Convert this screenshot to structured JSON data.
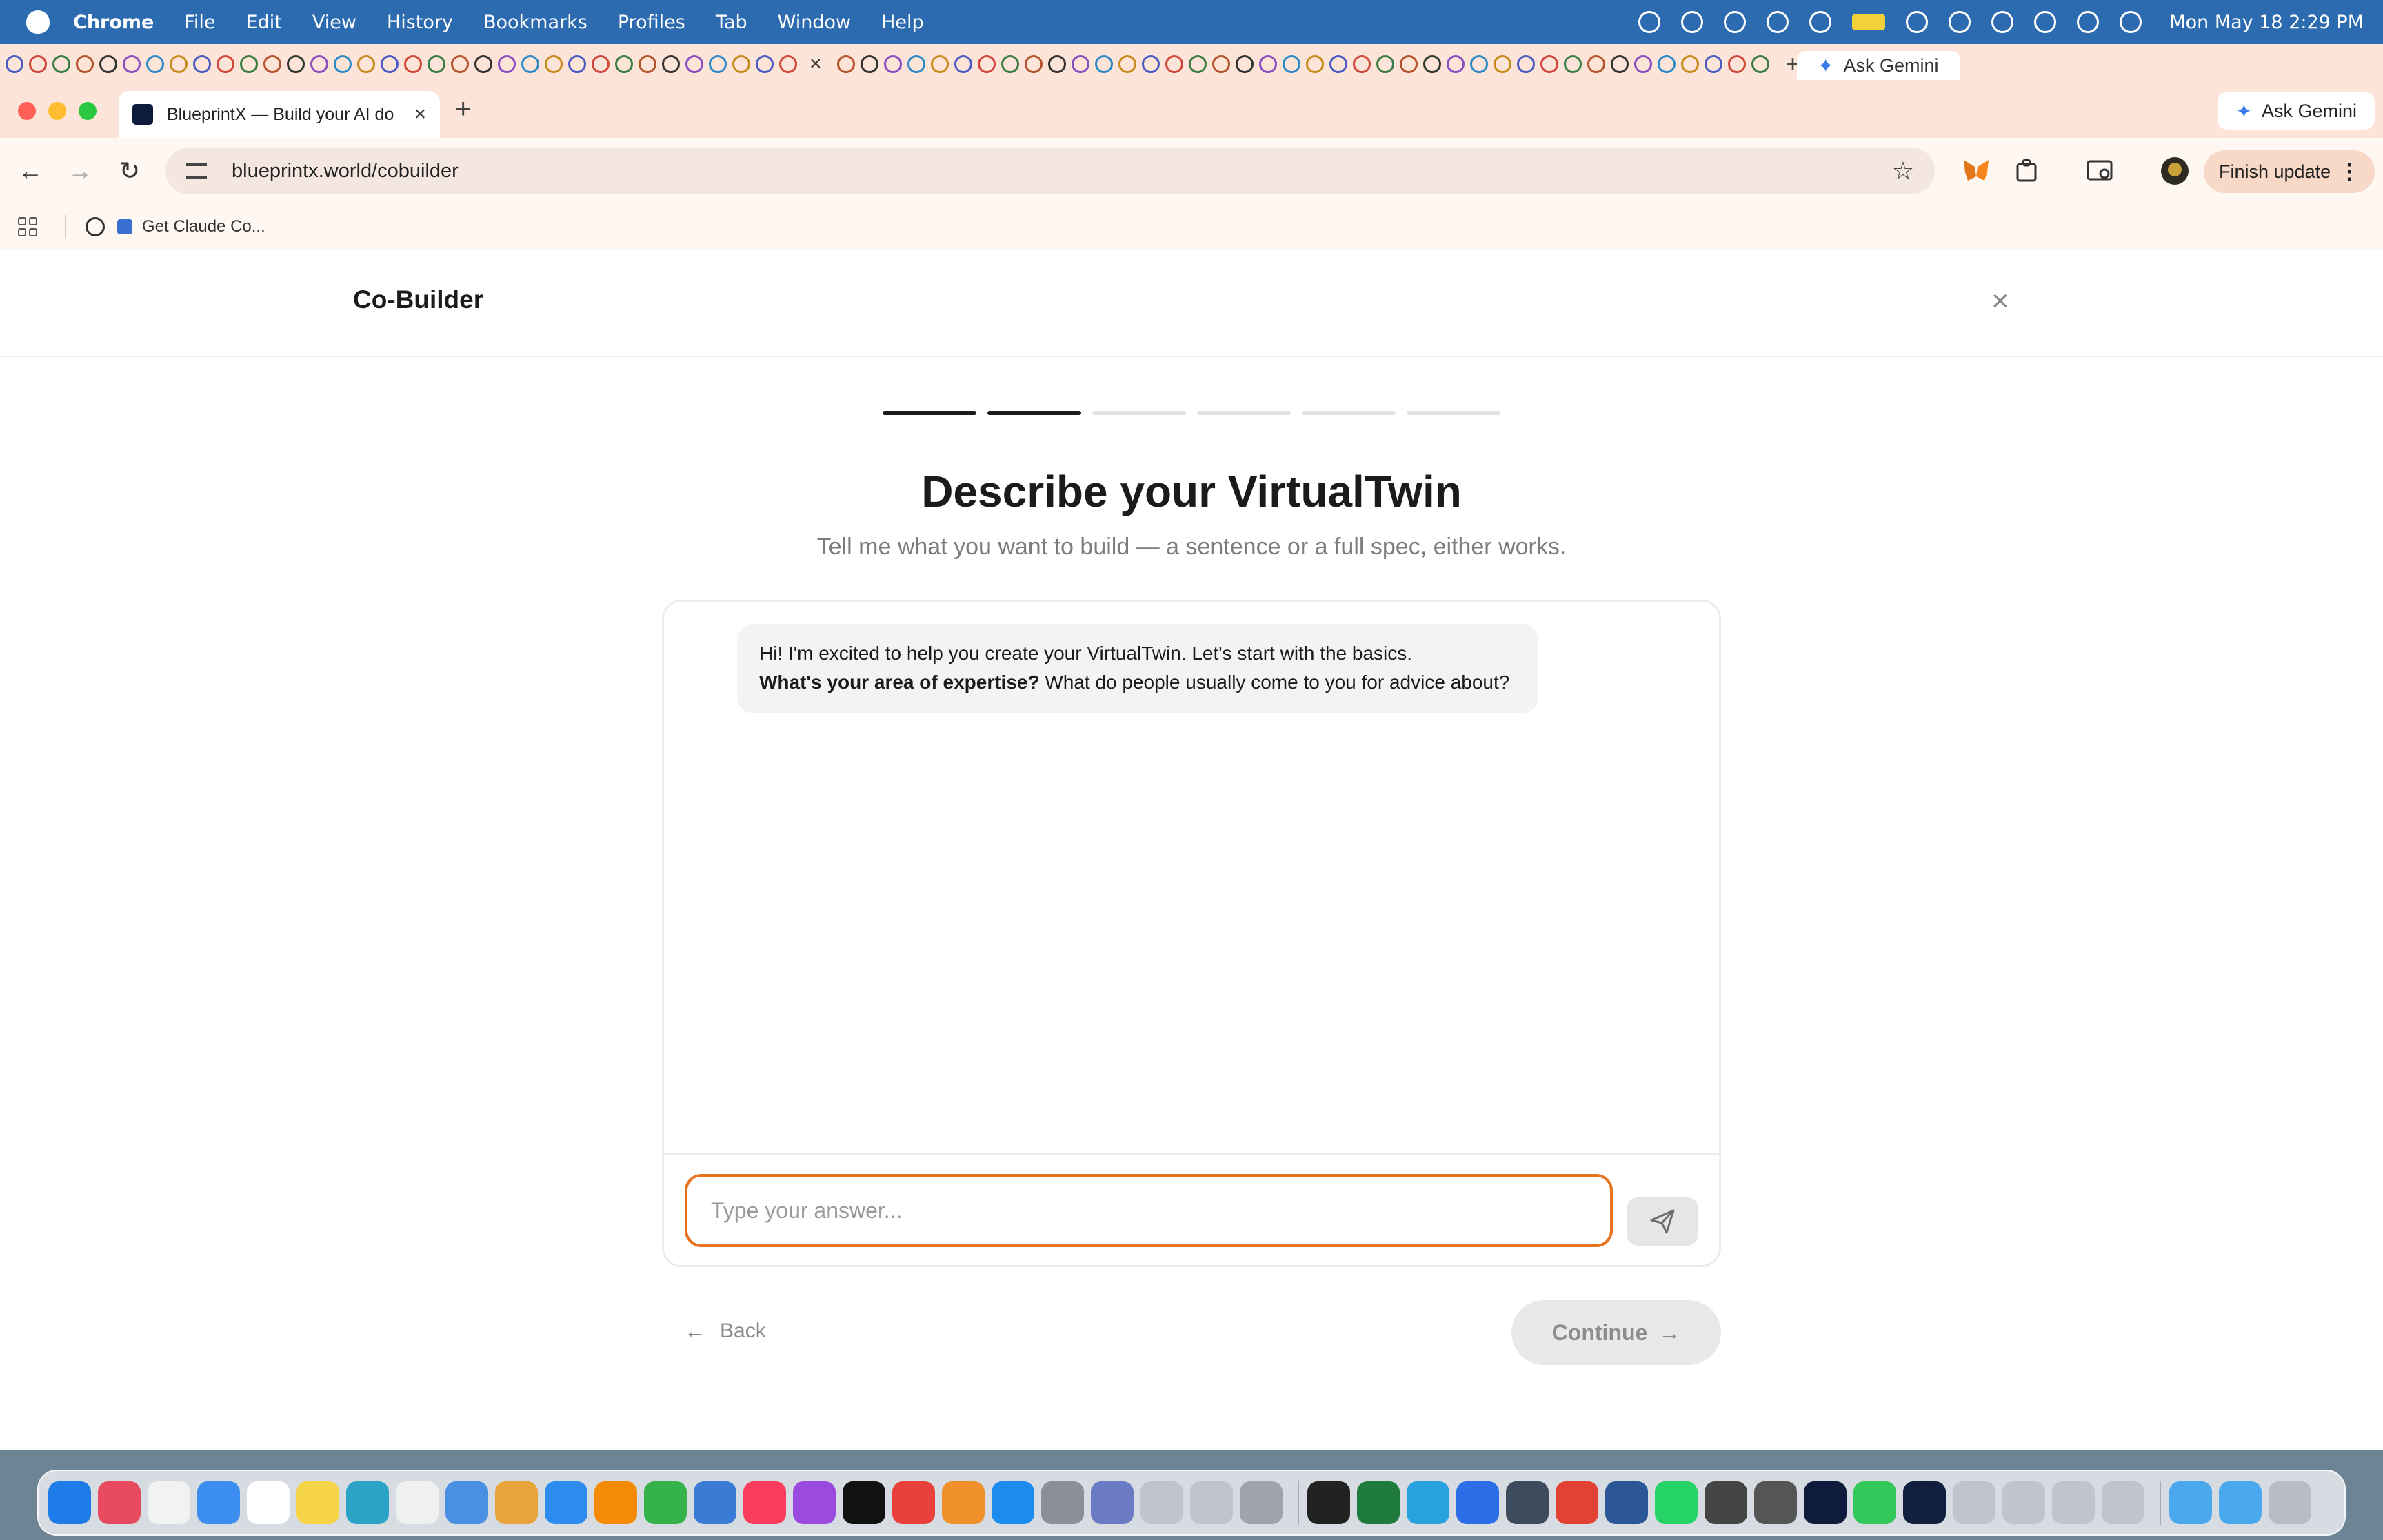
{
  "menubar": {
    "app_name": "Chrome",
    "items": [
      "File",
      "Edit",
      "View",
      "History",
      "Bookmarks",
      "Profiles",
      "Tab",
      "Window",
      "Help"
    ],
    "clock": "Mon May 18  2:29 PM"
  },
  "tabstrip": {
    "pinned_close": "×",
    "gemini_label": "Ask Gemini",
    "new_tab": "+"
  },
  "window": {
    "tab_title": "BlueprintX — Build your AI do",
    "tab_close": "×",
    "new_tab": "+",
    "ask_gemini": "Ask Gemini"
  },
  "toolbar": {
    "url": "blueprintx.world/cobuilder",
    "finish_update": "Finish update",
    "menu": "⋮"
  },
  "bookmarks": {
    "item": "Get Claude Co..."
  },
  "page": {
    "title": "Co-Builder",
    "close": "×",
    "progress": {
      "total_steps": 6,
      "completed_steps": 2
    },
    "heading": "Describe your VirtualTwin",
    "subheading": "Tell me what you want to build — a sentence or a full spec, either works.",
    "chat": {
      "line1": "Hi! I'm excited to help you create your VirtualTwin. Let's start with the basics.",
      "line2_bold": "What's your area of expertise?",
      "line2_rest": " What do people usually come to you for advice about?"
    },
    "input": {
      "placeholder": "Type your answer...",
      "value": ""
    },
    "back_label": "Back",
    "continue_label": "Continue"
  },
  "colors": {
    "accent_orange": "#e8731f",
    "menubar_blue": "#2d6bb0",
    "chrome_peach": "#fde4d8"
  },
  "icons": {
    "send": "paper-plane-icon",
    "back": "arrow-left-icon",
    "continue": "arrow-right-icon"
  }
}
